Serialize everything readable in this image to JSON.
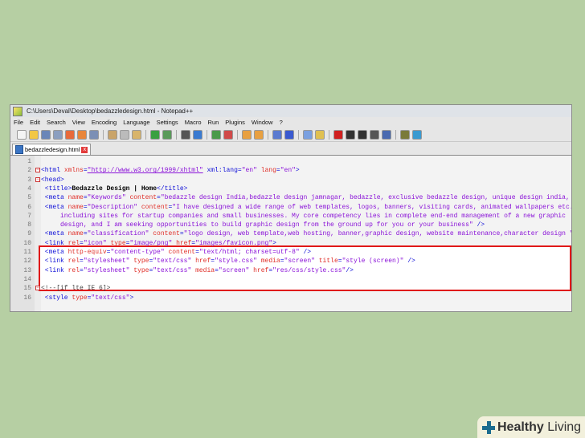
{
  "window": {
    "title": "C:\\Users\\Deval\\Desktop\\bedazzledesign.html - Notepad++"
  },
  "menu": [
    "File",
    "Edit",
    "Search",
    "View",
    "Encoding",
    "Language",
    "Settings",
    "Macro",
    "Run",
    "Plugins",
    "Window",
    "?"
  ],
  "toolbar_icons": [
    "new-file",
    "open",
    "save",
    "save-all",
    "close",
    "close-all",
    "print",
    "cut",
    "copy",
    "paste",
    "undo",
    "redo",
    "find",
    "replace",
    "zoom-in",
    "zoom-out",
    "sync-v",
    "sync-h",
    "wrap",
    "all-chars",
    "indent-guide",
    "user-lang",
    "record",
    "stop",
    "play",
    "play-multiple",
    "save-macro",
    "launch-browser",
    "spellcheck"
  ],
  "tab": {
    "label": "bedazzledesign.html",
    "close": "x"
  },
  "highlight_color": "#e01818",
  "lines": [
    {
      "n": "1",
      "fold": false,
      "tokens": []
    },
    {
      "n": "2",
      "fold": true,
      "tokens": [
        [
          "tag",
          "<html "
        ],
        [
          "attr",
          "xmlns"
        ],
        [
          "tag",
          "="
        ],
        [
          "url",
          "\"http://www.w3.org/1999/xhtml\""
        ],
        [
          "tag",
          " xml:lang="
        ],
        [
          "val",
          "\"en\""
        ],
        [
          "attr",
          " lang"
        ],
        [
          "tag",
          "="
        ],
        [
          "val",
          "\"en\""
        ],
        [
          "tag",
          ">"
        ]
      ]
    },
    {
      "n": "3",
      "fold": true,
      "tokens": [
        [
          "tag",
          "<head>"
        ]
      ]
    },
    {
      "n": "4",
      "fold": false,
      "tokens": [
        [
          "tag",
          " <title>"
        ],
        [
          "txt",
          "Bedazzle Design | Home"
        ],
        [
          "tag",
          "</title>"
        ]
      ]
    },
    {
      "n": "5",
      "fold": false,
      "tokens": [
        [
          "tag",
          " <meta "
        ],
        [
          "attr",
          "name"
        ],
        [
          "tag",
          "="
        ],
        [
          "val",
          "\"Keywords\""
        ],
        [
          "attr",
          " content"
        ],
        [
          "tag",
          "="
        ],
        [
          "val",
          "\"bedazzle design India,bedazzle design jamnagar, bedazzle, exclusive bedazzle design, unique design india, cus"
        ]
      ]
    },
    {
      "n": "6",
      "fold": false,
      "tokens": [
        [
          "tag",
          " <meta "
        ],
        [
          "attr",
          "name"
        ],
        [
          "tag",
          "="
        ],
        [
          "val",
          "\"Description\""
        ],
        [
          "attr",
          " content"
        ],
        [
          "tag",
          "="
        ],
        [
          "val",
          "\"I have designed a wide range of web templates, logos, banners, visiting cards, animated wallpapers etc."
        ]
      ]
    },
    {
      "n": "7",
      "fold": false,
      "tokens": [
        [
          "val",
          "     including sites for startup companies and small businesses. My core competency lies in complete end-end management of a new graphic"
        ]
      ]
    },
    {
      "n": "8",
      "fold": false,
      "tokens": [
        [
          "val",
          "     design, and I am seeking opportunities to build graphic design from the ground up for you or your business\""
        ],
        [
          "tag",
          " />"
        ]
      ]
    },
    {
      "n": "9",
      "fold": false,
      "tokens": [
        [
          "tag",
          " <meta "
        ],
        [
          "attr",
          "name"
        ],
        [
          "tag",
          "="
        ],
        [
          "val",
          "\"classification\""
        ],
        [
          "attr",
          " content"
        ],
        [
          "tag",
          "="
        ],
        [
          "val",
          "\"logo design, web template,web hosting, banner,graphic design, website maintenance,character design \""
        ],
        [
          "tag",
          " />"
        ]
      ]
    },
    {
      "n": "10",
      "fold": false,
      "tokens": [
        [
          "tag",
          " <link "
        ],
        [
          "attr",
          "rel"
        ],
        [
          "tag",
          "="
        ],
        [
          "val",
          "\"icon\""
        ],
        [
          "attr",
          " type"
        ],
        [
          "tag",
          "="
        ],
        [
          "val",
          "\"image/png\""
        ],
        [
          "attr",
          " href"
        ],
        [
          "tag",
          "="
        ],
        [
          "val",
          "\"images/favicon.png\""
        ],
        [
          "tag",
          ">"
        ]
      ]
    },
    {
      "n": "11",
      "fold": false,
      "tokens": [
        [
          "tag",
          " <meta "
        ],
        [
          "attr",
          "http-equiv"
        ],
        [
          "tag",
          "="
        ],
        [
          "val",
          "\"content-type\""
        ],
        [
          "attr",
          " content"
        ],
        [
          "tag",
          "="
        ],
        [
          "val",
          "\"text/html; charset=utf-8\""
        ],
        [
          "tag",
          " />"
        ]
      ]
    },
    {
      "n": "12",
      "fold": false,
      "tokens": [
        [
          "tag",
          " <link "
        ],
        [
          "attr",
          "rel"
        ],
        [
          "tag",
          "="
        ],
        [
          "val",
          "\"stylesheet\""
        ],
        [
          "attr",
          " type"
        ],
        [
          "tag",
          "="
        ],
        [
          "val",
          "\"text/css\""
        ],
        [
          "attr",
          " href"
        ],
        [
          "tag",
          "="
        ],
        [
          "val",
          "\"style.css\""
        ],
        [
          "attr",
          " media"
        ],
        [
          "tag",
          "="
        ],
        [
          "val",
          "\"screen\""
        ],
        [
          "attr",
          " title"
        ],
        [
          "tag",
          "="
        ],
        [
          "val",
          "\"style (screen)\""
        ],
        [
          "tag",
          " />"
        ]
      ]
    },
    {
      "n": "13",
      "fold": false,
      "tokens": [
        [
          "tag",
          " <link "
        ],
        [
          "attr",
          "rel"
        ],
        [
          "tag",
          "="
        ],
        [
          "val",
          "\"stylesheet\""
        ],
        [
          "attr",
          " type"
        ],
        [
          "tag",
          "="
        ],
        [
          "val",
          "\"text/css\""
        ],
        [
          "attr",
          " media"
        ],
        [
          "tag",
          "="
        ],
        [
          "val",
          "\"screen\""
        ],
        [
          "attr",
          " href"
        ],
        [
          "tag",
          "="
        ],
        [
          "val",
          "\"res/css/style.css\""
        ],
        [
          "tag",
          "/>"
        ]
      ]
    },
    {
      "n": "14",
      "fold": false,
      "tokens": []
    },
    {
      "n": "15",
      "fold": true,
      "tokens": [
        [
          "cmt",
          "<!--[if lte IE 6]>"
        ]
      ]
    },
    {
      "n": "16",
      "fold": false,
      "tokens": [
        [
          "tag",
          " <style "
        ],
        [
          "attr",
          "type"
        ],
        [
          "tag",
          "="
        ],
        [
          "val",
          "\"text/css\""
        ],
        [
          "tag",
          ">"
        ]
      ]
    }
  ],
  "brand": {
    "logo_text_bold": "Healthy",
    "logo_text": " Living"
  }
}
